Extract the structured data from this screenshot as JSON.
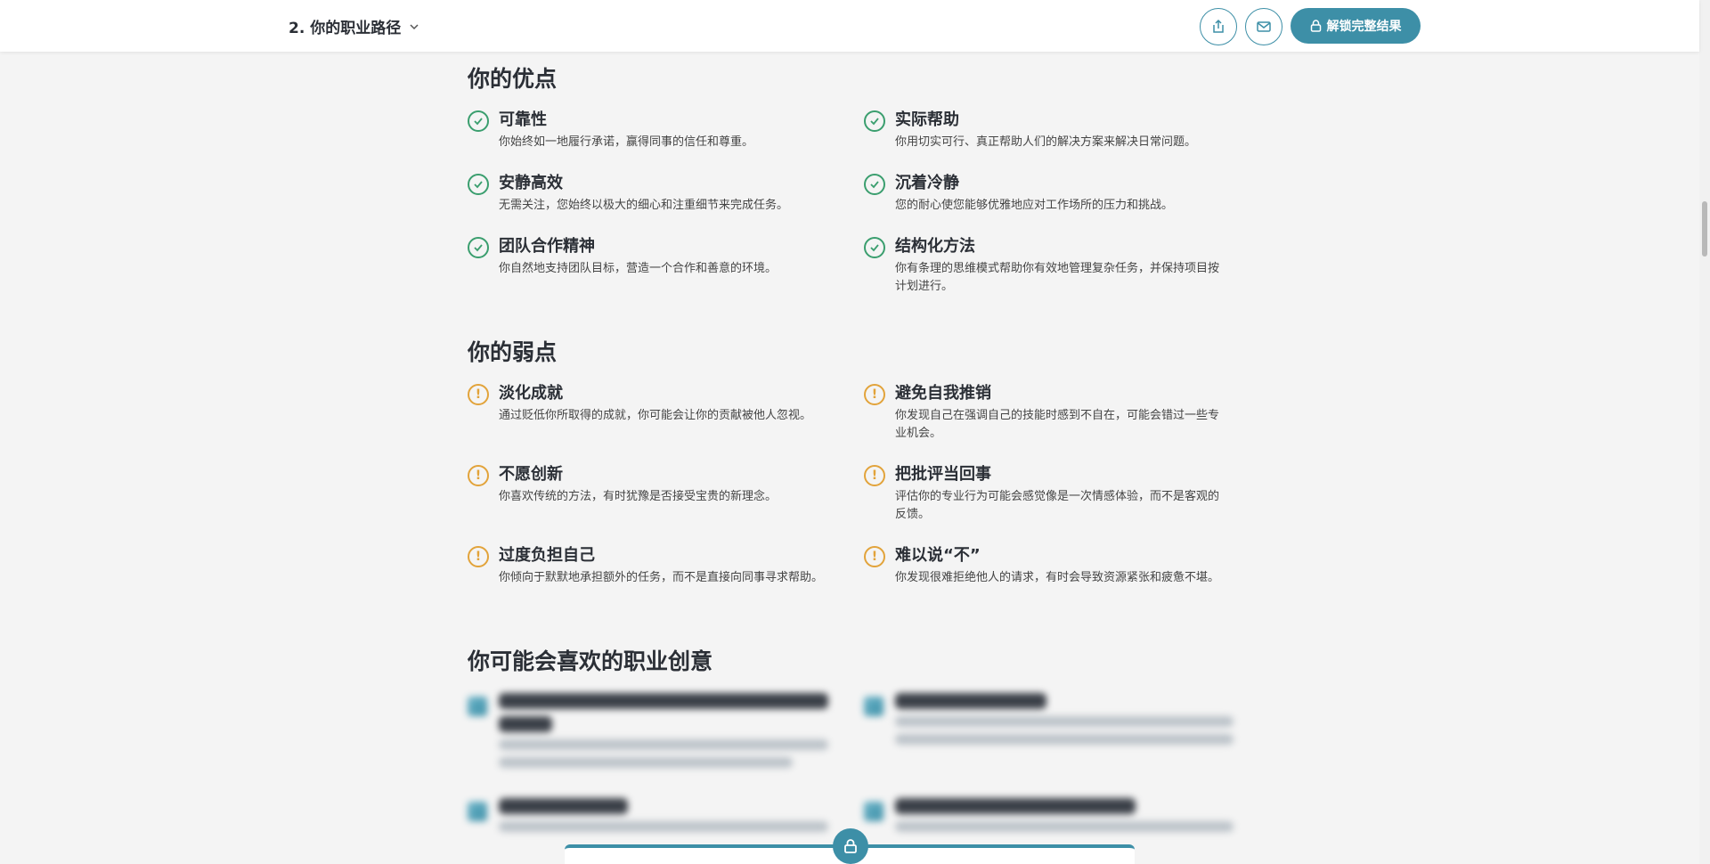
{
  "header": {
    "section_title": "2. 你的职业路径",
    "unlock_label": "解锁完整结果",
    "icons": {
      "share": "share-icon",
      "mail": "mail-icon",
      "lock": "lock-icon",
      "chevron": "chevron-down-icon"
    }
  },
  "strengths": {
    "heading": "你的优点",
    "items": [
      {
        "title": "可靠性",
        "desc": "你始终如一地履行承诺，赢得同事的信任和尊重。"
      },
      {
        "title": "实际帮助",
        "desc": "你用切实可行、真正帮助人们的解决方案来解决日常问题。"
      },
      {
        "title": "安静高效",
        "desc": "无需关注，您始终以极大的细心和注重细节来完成任务。"
      },
      {
        "title": "沉着冷静",
        "desc": "您的耐心使您能够优雅地应对工作场所的压力和挑战。"
      },
      {
        "title": "团队合作精神",
        "desc": "你自然地支持团队目标，营造一个合作和善意的环境。"
      },
      {
        "title": "结构化方法",
        "desc": "你有条理的思维模式帮助你有效地管理复杂任务，并保持项目按计划进行。"
      }
    ]
  },
  "weaknesses": {
    "heading": "你的弱点",
    "items": [
      {
        "title": "淡化成就",
        "desc": "通过贬低你所取得的成就，你可能会让你的贡献被他人忽视。"
      },
      {
        "title": "避免自我推销",
        "desc": "你发现自己在强调自己的技能时感到不自在，可能会错过一些专业机会。"
      },
      {
        "title": "不愿创新",
        "desc": "你喜欢传统的方法，有时犹豫是否接受宝贵的新理念。"
      },
      {
        "title": "把批评当回事",
        "desc": "评估你的专业行为可能会感觉像是一次情感体验，而不是客观的反馈。"
      },
      {
        "title": "过度负担自己",
        "desc": "你倾向于默默地承担额外的任务，而不是直接向同事寻求帮助。"
      },
      {
        "title": "难以说“不”",
        "desc": "你发现很难拒绝他人的请求，有时会导致资源紧张和疲惫不堪。"
      }
    ]
  },
  "careers": {
    "heading": "你可能会喜欢的职业创意"
  },
  "colors": {
    "accent": "#3d8fa7",
    "check": "#3a9e6e",
    "warn": "#e2a33a"
  }
}
